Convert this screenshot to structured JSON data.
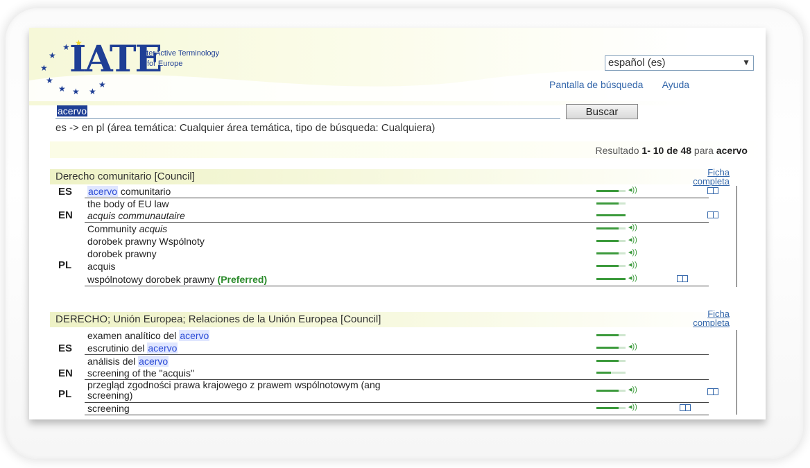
{
  "logo": {
    "name": "IATE",
    "tagline_line1": "InterActive Terminology",
    "tagline_line2": "for Europe"
  },
  "language_select": {
    "value": "español (es)"
  },
  "top_links": [
    "Pantalla de búsqueda",
    "Ayuda"
  ],
  "search": {
    "value": "acervo",
    "button_label": "Buscar"
  },
  "criteria_text": "es -> en pl (área temática: Cualquier área temática, tipo de búsqueda: Cualquiera)",
  "results": {
    "prefix": "Resultado",
    "range": "1- 10 de 48",
    "middle": "para",
    "term": "acervo"
  },
  "colors": {
    "brand_blue": "#1f3f95",
    "link_blue": "#3366aa",
    "highlight": "#2b4bd6",
    "preferred_green": "#2a8a2a"
  },
  "entries": [
    {
      "domain": "Derecho comunitario [Council]",
      "ficha_line1": "Ficha",
      "ficha_line2": "completa",
      "groups": [
        {
          "lang": "ES",
          "terms": [
            {
              "pre": "",
              "hl": "acervo",
              "post": " comunitario",
              "reliability": 0.75,
              "has_sound": true
            }
          ]
        },
        {
          "lang": "EN",
          "terms": [
            {
              "text": "the body of EU law",
              "reliability": 0.75,
              "has_sound": false
            },
            {
              "text": "acquis communautaire",
              "italic": true,
              "reliability": 1.0,
              "has_sound": false
            }
          ]
        },
        {
          "lang": "PL",
          "terms": [
            {
              "pre": "Community ",
              "italic_part": "acquis",
              "reliability": 0.75,
              "has_sound": true
            },
            {
              "text": "dorobek prawny Wspólnoty",
              "reliability": 0.75,
              "has_sound": true
            },
            {
              "text": "dorobek prawny",
              "reliability": 0.75,
              "has_sound": true
            },
            {
              "text": "acquis",
              "reliability": 0.75,
              "has_sound": true
            },
            {
              "text": "wspólnotowy dorobek prawny",
              "preferred": "(Preferred)",
              "reliability": 1.0,
              "has_sound": true
            }
          ]
        }
      ]
    },
    {
      "domain": "DERECHO; Unión Europea; Relaciones de la Unión Europea [Council]",
      "ficha_line1": "Ficha",
      "ficha_line2": "completa",
      "groups": [
        {
          "lang": "ES",
          "terms": [
            {
              "pre": "examen analítico del ",
              "hl": "acervo",
              "post": "",
              "reliability": 0.75,
              "has_sound": false
            },
            {
              "pre": "escrutinio del ",
              "hl": "acervo",
              "post": "",
              "reliability": 0.75,
              "has_sound": true
            },
            {
              "pre": "análisis del ",
              "hl": "acervo",
              "post": "",
              "reliability": 0.75,
              "has_sound": false
            }
          ]
        },
        {
          "lang": "EN",
          "terms": [
            {
              "text": "screening of the \"acquis\"",
              "reliability": 0.5,
              "has_sound": false
            }
          ]
        },
        {
          "lang": "PL",
          "terms": [
            {
              "text": "przegląd zgodności prawa krajowego z prawem wspólnotowym (ang",
              "text2": "screening)",
              "reliability": 0.75,
              "has_sound": true
            },
            {
              "text": "screening",
              "reliability": 0.75,
              "has_sound": true
            }
          ]
        }
      ]
    }
  ]
}
